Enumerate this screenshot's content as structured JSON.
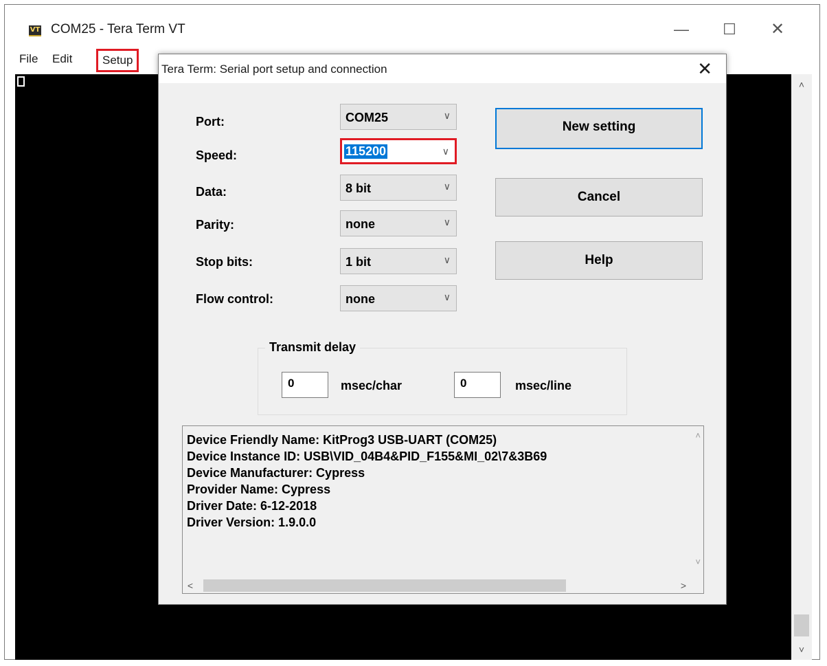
{
  "window": {
    "icon_text": "VT",
    "title": "COM25 - Tera Term VT",
    "minimize_glyph": "—",
    "maximize_glyph": "☐",
    "close_glyph": "✕"
  },
  "menu": {
    "file": "File",
    "edit": "Edit",
    "setup": "Setup"
  },
  "dialog": {
    "title": "Tera Term: Serial port setup and connection",
    "close_glyph": "✕",
    "fields": {
      "port_label": "Port:",
      "port_value": "COM25",
      "speed_label": "Speed:",
      "speed_value": "115200",
      "data_label": "Data:",
      "data_value": "8 bit",
      "parity_label": "Parity:",
      "parity_value": "none",
      "stop_bits_label": "Stop bits:",
      "stop_bits_value": "1 bit",
      "flow_control_label": "Flow control:",
      "flow_control_value": "none"
    },
    "buttons": {
      "new_setting": "New setting",
      "cancel": "Cancel",
      "help": "Help"
    },
    "transmit_delay": {
      "title": "Transmit delay",
      "char_value": "0",
      "char_unit": "msec/char",
      "line_value": "0",
      "line_unit": "msec/line"
    },
    "info_lines": [
      "Device Friendly Name: KitProg3 USB-UART (COM25)",
      "Device Instance ID: USB\\VID_04B4&PID_F155&MI_02\\7&3B69",
      "Device Manufacturer: Cypress",
      "Provider Name: Cypress",
      "Driver Date: 6-12-2018",
      "Driver Version: 1.9.0.0"
    ]
  },
  "colors": {
    "highlight_box": "#e01b24",
    "selection": "#0078d7",
    "terminal_bg": "#000000"
  },
  "icons": {
    "chevron": "chevron-down-icon"
  }
}
